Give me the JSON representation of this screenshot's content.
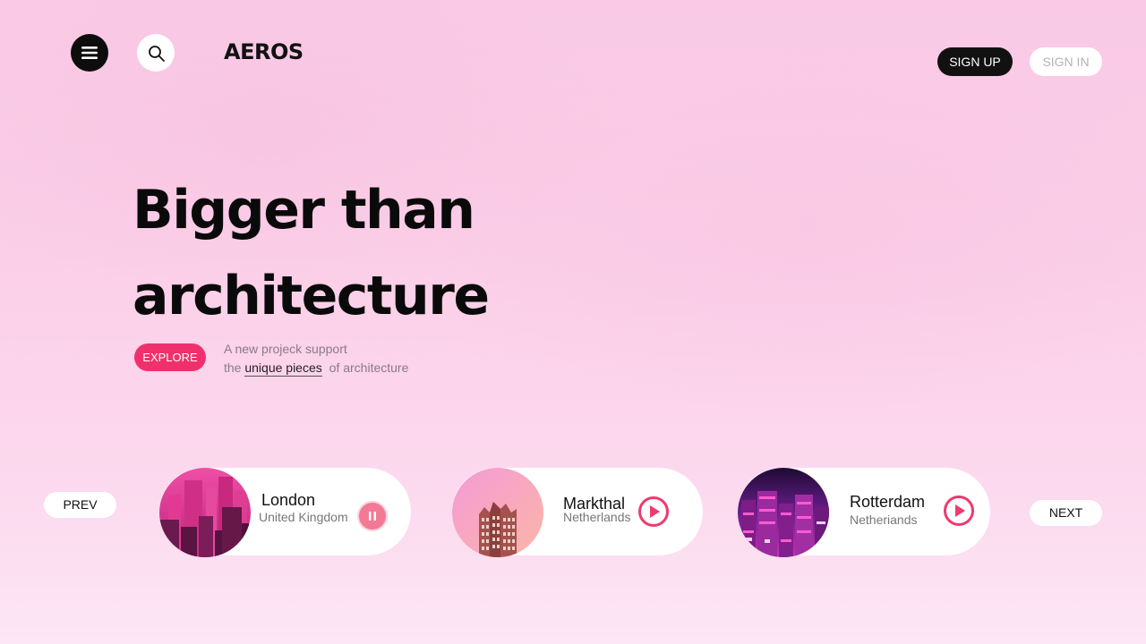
{
  "header": {
    "menu_icon": "menu-icon",
    "search_icon": "search-icon",
    "logo": "AEROS",
    "signup_label": "SIGN UP",
    "signin_label": "SIGN IN"
  },
  "hero": {
    "line1": "Bigger than",
    "line2": "architecture",
    "explore_label": "EXPLORE",
    "tagline_line1": "A new projeck support",
    "tagline_prefix": "the",
    "tagline_link": "unique pieces",
    "tagline_suffix": "of architecture"
  },
  "carousel": {
    "prev_label": "PREV",
    "next_label": "NEXT",
    "cards": [
      {
        "city": "London",
        "country": "United Kingdom",
        "control": "pause-icon"
      },
      {
        "city": "Markthal",
        "country": "Netherlands",
        "control": "play-icon"
      },
      {
        "city": "Rotterdam",
        "country": "Netheriands",
        "control": "play-icon"
      }
    ]
  },
  "colors": {
    "accent": "#f0306c",
    "play": "#ee3a6d",
    "pause": "#f27a95",
    "dark": "#111111"
  }
}
